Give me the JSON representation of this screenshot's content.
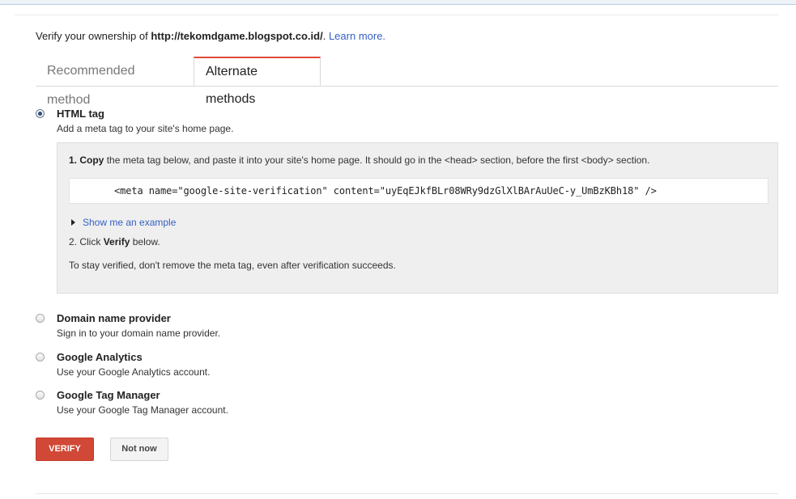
{
  "ownership": {
    "prefix": "Verify your ownership of ",
    "url": "http://tekomdgame.blogspot.co.id/",
    "suffix": ".",
    "learn_more": "Learn more."
  },
  "tabs": [
    {
      "label": "Recommended method",
      "active": false
    },
    {
      "label": "Alternate methods",
      "active": true
    }
  ],
  "methods": {
    "html_tag": {
      "title": "HTML tag",
      "desc": "Add a meta tag to your site's home page.",
      "selected": true
    },
    "domain": {
      "title": "Domain name provider",
      "desc": "Sign in to your domain name provider.",
      "selected": false
    },
    "analytics": {
      "title": "Google Analytics",
      "desc": "Use your Google Analytics account.",
      "selected": false
    },
    "tag_manager": {
      "title": "Google Tag Manager",
      "desc": "Use your Google Tag Manager account.",
      "selected": false
    }
  },
  "panel": {
    "step1_num": "1.",
    "step1_bold": "Copy",
    "step1_text": " the meta tag below, and paste it into your site's home page. It should go in the <head> section, before the first <body> section.",
    "meta_tag": "<meta name=\"google-site-verification\" content=\"uyEqEJkfBLr08WRy9dzGlXlBArAuUeC-y_UmBzKBh18\" />",
    "show_example": "Show me an example",
    "step2_prefix": "2. Click ",
    "step2_bold": "Verify",
    "step2_suffix": " below.",
    "note": "To stay verified, don't remove the meta tag, even after verification succeeds."
  },
  "buttons": {
    "verify": "VERIFY",
    "not_now": "Not now"
  },
  "colors": {
    "accent": "#dd4b39",
    "verify_bg": "#d14836",
    "link": "#3660c4"
  }
}
